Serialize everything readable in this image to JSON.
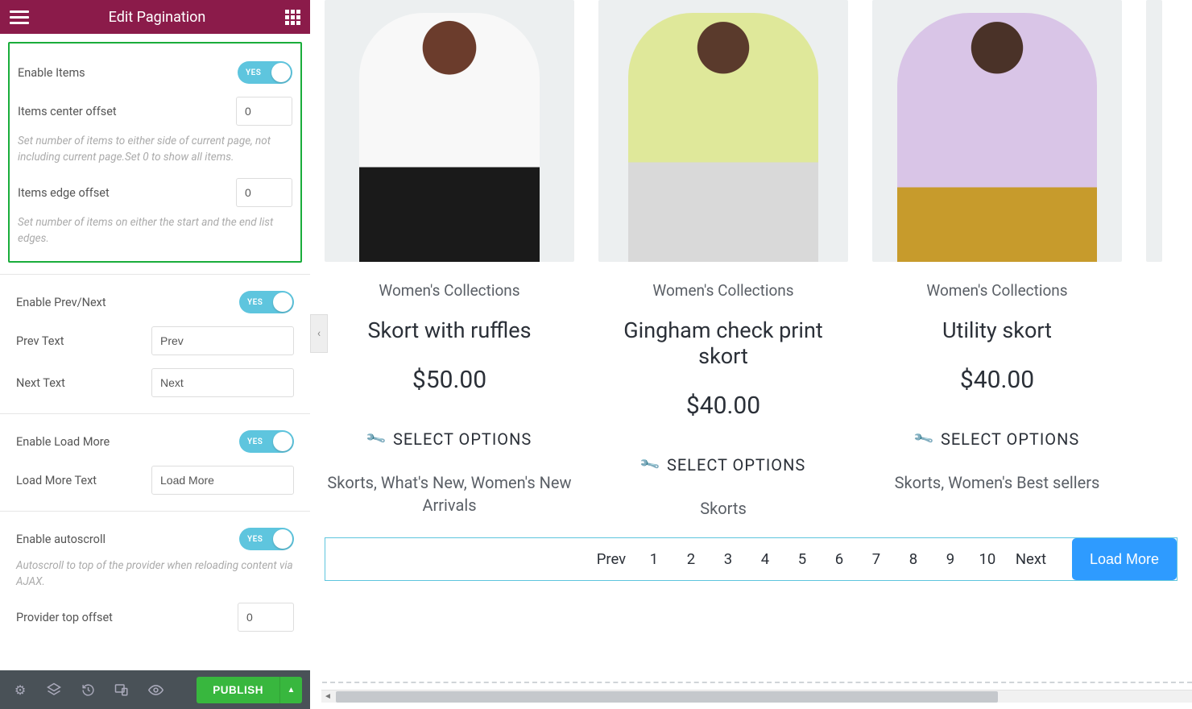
{
  "sidebar": {
    "title": "Edit Pagination",
    "groups": {
      "items": {
        "enable_label": "Enable Items",
        "enable_toggle": "YES",
        "center_offset_label": "Items center offset",
        "center_offset_value": "0",
        "center_offset_help": "Set number of items to either side of current page, not including current page.Set 0 to show all items.",
        "edge_offset_label": "Items edge offset",
        "edge_offset_value": "0",
        "edge_offset_help": "Set number of items on either the start and the end list edges."
      },
      "prevnext": {
        "enable_label": "Enable Prev/Next",
        "enable_toggle": "YES",
        "prev_label": "Prev Text",
        "prev_value": "Prev",
        "next_label": "Next Text",
        "next_value": "Next"
      },
      "loadmore": {
        "enable_label": "Enable Load More",
        "enable_toggle": "YES",
        "text_label": "Load More Text",
        "text_value": "Load More"
      },
      "autoscroll": {
        "enable_label": "Enable autoscroll",
        "enable_toggle": "YES",
        "help": "Autoscroll to top of the provider when reloading content via AJAX.",
        "offset_label": "Provider top offset",
        "offset_value": "0"
      }
    },
    "publish": "PUBLISH"
  },
  "preview": {
    "products": [
      {
        "category": "Women's Collections",
        "name": "Skort with ruffles",
        "price": "$50.00",
        "select": "SELECT OPTIONS",
        "tags": "Skorts, What's New, Women's New Arrivals"
      },
      {
        "category": "Women's Collections",
        "name": "Gingham check print skort",
        "price": "$40.00",
        "select": "SELECT OPTIONS",
        "tags": "Skorts"
      },
      {
        "category": "Women's Collections",
        "name": "Utility skort",
        "price": "$40.00",
        "select": "SELECT OPTIONS",
        "tags": "Skorts, Women's Best sellers"
      }
    ],
    "pager": {
      "prev": "Prev",
      "pages": [
        "1",
        "2",
        "3",
        "4",
        "5",
        "6",
        "7",
        "8",
        "9",
        "10"
      ],
      "next": "Next",
      "loadmore": "Load More"
    }
  }
}
